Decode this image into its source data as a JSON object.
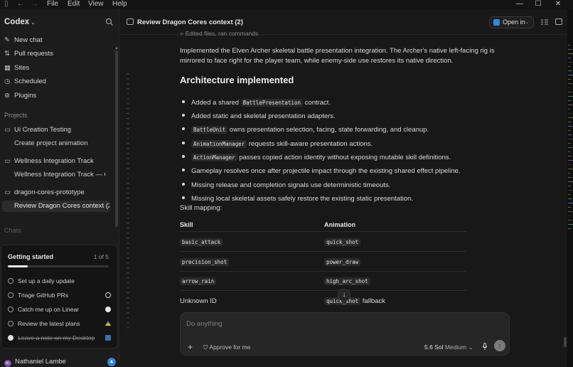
{
  "menu": {
    "file": "File",
    "edit": "Edit",
    "view": "View",
    "help": "Help"
  },
  "sidebar": {
    "brand": "Codex",
    "nav": [
      {
        "label": "New chat",
        "icon": "compose-icon"
      },
      {
        "label": "Pull requests",
        "icon": "pull-request-icon"
      },
      {
        "label": "Sites",
        "icon": "sites-icon"
      },
      {
        "label": "Scheduled",
        "icon": "clock-icon"
      },
      {
        "label": "Plugins",
        "icon": "plugin-icon"
      }
    ],
    "projects_label": "Projects",
    "projects": [
      {
        "name": "Ui Creation Testing",
        "threads": [
          "Create project animation"
        ]
      },
      {
        "name": "Wellness Integration Track",
        "threads": [
          "Wellness Integration Track — Co"
        ]
      },
      {
        "name": "dragon-cores-prototype",
        "threads": [
          "Review Dragon Cores context (2)"
        ]
      }
    ],
    "chats_label": "Chats",
    "getting_started": {
      "title": "Getting started",
      "count": "1 of 5",
      "progress": 0.2,
      "items": [
        {
          "label": "Set up a daily update",
          "done": false,
          "icon": ""
        },
        {
          "label": "Triage GitHub PRs",
          "done": false,
          "icon": "github-icon"
        },
        {
          "label": "Catch me up on Linear",
          "done": false,
          "icon": "linear-icon"
        },
        {
          "label": "Review the latest plans",
          "done": false,
          "icon": "google-drive-icon"
        },
        {
          "label": "Leave a note on my Desktop",
          "done": true,
          "icon": "folder-icon"
        }
      ]
    },
    "user": {
      "name": "Nathaniel Lambe",
      "initials": "NL"
    }
  },
  "header": {
    "title": "Review Dragon Cores context (2)",
    "more": "···",
    "open_in": "Open in"
  },
  "content": {
    "clipped_row": "Edited files, ran commands",
    "intro": "Implemented the Elven Archer skeletal battle presentation integration. The Archer's native left-facing rig is mirrored to face right for the player team, while enemy-side use restores its native direction.",
    "heading": "Architecture implemented",
    "bullets": [
      {
        "pre": "Added a shared ",
        "code": "BattlePresentation",
        "post": " contract."
      },
      {
        "pre": "Added static and skeletal presentation adapters.",
        "code": "",
        "post": ""
      },
      {
        "pre": "",
        "code": "BattleUnit",
        "post": " owns presentation selection, facing, state forwarding, and cleanup."
      },
      {
        "pre": "",
        "code": "AnimationManager",
        "post": " requests skill-aware presentation actions."
      },
      {
        "pre": "",
        "code": "ActionManager",
        "post": " passes copied action identity without exposing mutable skill definitions."
      },
      {
        "pre": "Gameplay resolves once after projectile impact through the existing shared effect pipeline.",
        "code": "",
        "post": ""
      },
      {
        "pre": "Missing release and completion signals use deterministic timeouts.",
        "code": "",
        "post": ""
      },
      {
        "pre": "Missing local skeletal assets safely restore the existing static presentation.",
        "code": "",
        "post": ""
      }
    ],
    "skill_mapping_label": "Skill mapping:",
    "table": {
      "headers": [
        "Skill",
        "Animation"
      ],
      "rows": [
        {
          "skill": "basic_attack",
          "skill_code": true,
          "anim": "quick_shot",
          "anim_suffix": ""
        },
        {
          "skill": "precision_shot",
          "skill_code": true,
          "anim": "power_draw",
          "anim_suffix": ""
        },
        {
          "skill": "arrow_rain",
          "skill_code": true,
          "anim": "high_arc_shot",
          "anim_suffix": ""
        },
        {
          "skill": "Unknown ID",
          "skill_code": false,
          "anim": "quick_shot",
          "anim_suffix": " fallback"
        }
      ]
    }
  },
  "composer": {
    "placeholder": "Do anything",
    "approve": "Approve for me",
    "model": "5.6 Sol",
    "effort": "Medium"
  },
  "colors": {
    "accent_blue": "#3b82d6",
    "vscode_blue": "#2d8cdc",
    "bg": "#181818",
    "sidebar_bg": "#1c1c1c"
  }
}
